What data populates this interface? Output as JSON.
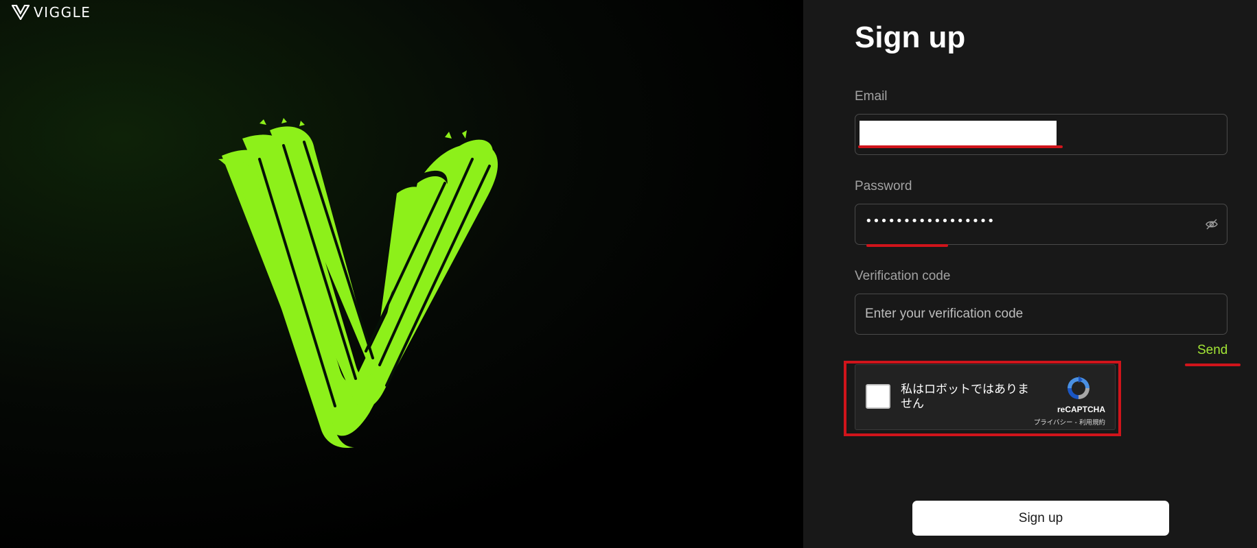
{
  "brand": {
    "name": "VIGGLE",
    "icon": "viggle-logo-icon"
  },
  "colors": {
    "accent": "#a3e635",
    "highlight": "#d0141b",
    "logo_green": "#8df01a"
  },
  "form": {
    "title": "Sign up",
    "email": {
      "label": "Email",
      "value": ""
    },
    "password": {
      "label": "Password",
      "masked_value": "•••••••••••••••••",
      "toggle_icon": "eye-slash-icon"
    },
    "verification": {
      "label": "Verification code",
      "placeholder": "Enter your verification code",
      "value": ""
    },
    "send_label": "Send",
    "recaptcha": {
      "checkbox_label": "私はロボットではありません",
      "brand": "reCAPTCHA",
      "links": "プライバシー - 利用規約",
      "icon": "recaptcha-icon"
    },
    "submit_label": "Sign up"
  }
}
